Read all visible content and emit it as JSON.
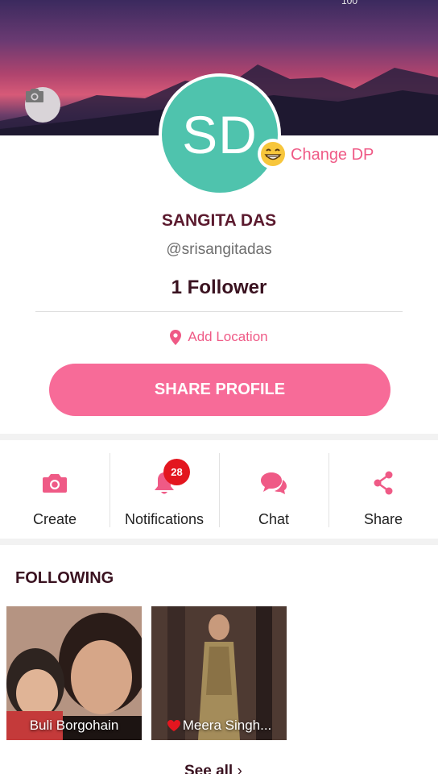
{
  "status": {
    "text": "100"
  },
  "profile": {
    "initials": "SD",
    "change_dp_label": "Change DP",
    "name": "SANGITA DAS",
    "handle": "@srisangitadas",
    "followers": "1 Follower",
    "location_label": "Add Location",
    "share_profile_label": "SHARE PROFILE"
  },
  "actions": {
    "create": "Create",
    "notifications": "Notifications",
    "notifications_badge": "28",
    "chat": "Chat",
    "share": "Share"
  },
  "following": {
    "title": "FOLLOWING",
    "items": [
      {
        "name": "Buli Borgohain"
      },
      {
        "name": "Meera Singh..."
      }
    ],
    "see_all_label": "See all"
  },
  "colors": {
    "accent": "#ef5a86",
    "button": "#f76b98",
    "avatar": "#4fc3ad",
    "badge": "#e3161f"
  }
}
